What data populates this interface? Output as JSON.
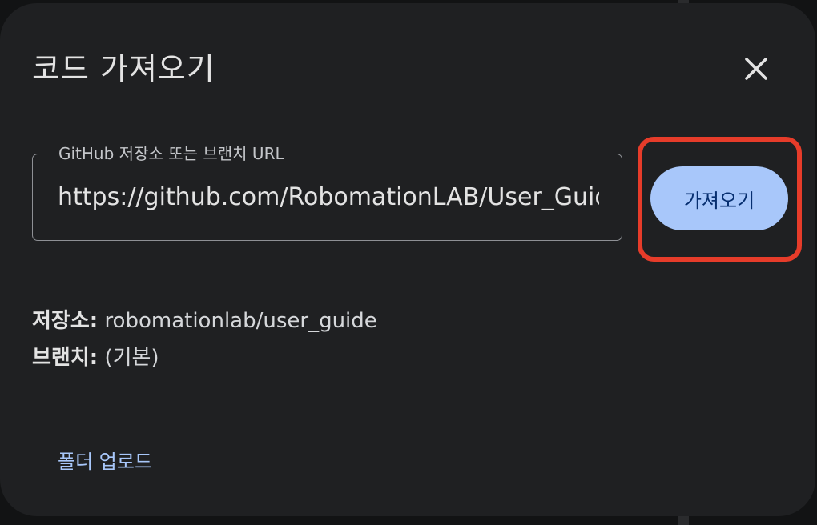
{
  "dialog": {
    "title": "코드 가져오기",
    "close_icon": "close-icon"
  },
  "url_field": {
    "label": "GitHub 저장소 또는 브랜치 URL",
    "value": "https://github.com/RobomationLAB/User_Guide"
  },
  "import_button": {
    "label": "가져오기"
  },
  "info": {
    "repo_key": "저장소:",
    "repo_value": "robomationlab/user_guide",
    "branch_key": "브랜치:",
    "branch_value": "(기본)"
  },
  "footer": {
    "upload_link": "폴더 업로드"
  },
  "colors": {
    "dialog_bg": "#1f2022",
    "accent_button": "#a8c7fa",
    "highlight": "#e63c2a"
  }
}
